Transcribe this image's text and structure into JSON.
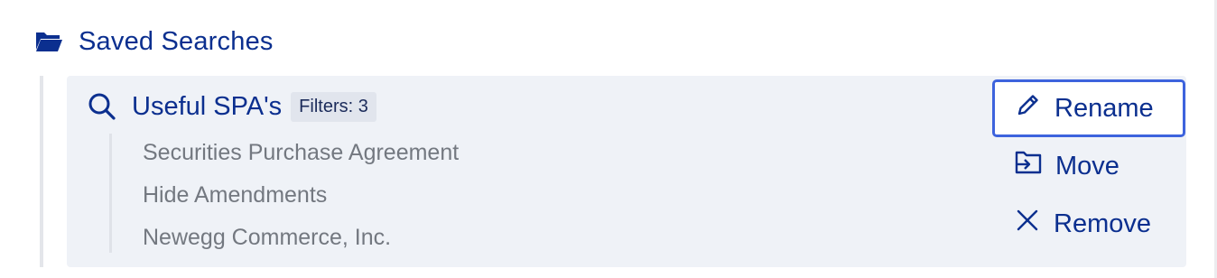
{
  "folder": {
    "title": "Saved Searches",
    "icon": "folder-open-icon"
  },
  "saved_search": {
    "name": "Useful SPA's",
    "filters_badge": "Filters: 3",
    "icon": "search-icon",
    "criteria": [
      "Securities Purchase Agreement",
      "Hide Amendments",
      "Newegg Commerce, Inc."
    ]
  },
  "actions": {
    "rename": {
      "label": "Rename",
      "icon": "pencil-icon"
    },
    "move": {
      "label": "Move",
      "icon": "move-folder-icon"
    },
    "remove": {
      "label": "Remove",
      "icon": "close-icon"
    }
  },
  "colors": {
    "accent": "#0b2f8f",
    "focus_ring": "#3d63dd",
    "card_bg": "#eff2f7",
    "muted_text": "#737880"
  }
}
